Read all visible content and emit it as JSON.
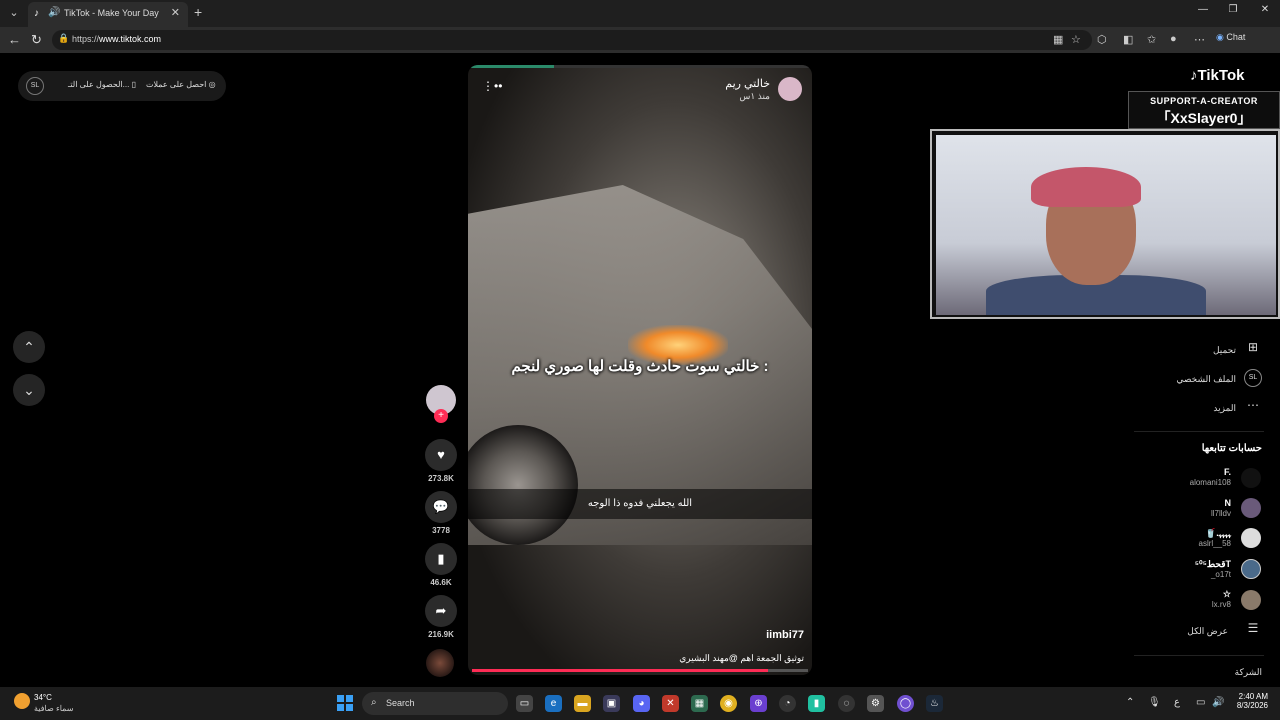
{
  "browser": {
    "tab_title": "TikTok - Make Your Day",
    "url_prefix": "https://",
    "url_host": "www.tiktok.com",
    "chat_label": "Chat"
  },
  "promo": {
    "item1": "احصل على عملات",
    "item2": "الحصول على التـ..."
  },
  "video": {
    "author_display": "خالتي ريم",
    "posted": "منذ ١س",
    "caption_main": "خالتي سوت حادث وقلت لها صوري لنجم :",
    "caption_sub": "الله يجعلني فدوه ذا الوجه",
    "username": "iimbi77",
    "description": "توثيق الجمعة اهم @مهند البشيري",
    "progress_fraction": 0.88
  },
  "actions": {
    "likes": "273.8K",
    "comments": "3778",
    "saves": "46.6K",
    "shares": "216.9K"
  },
  "overlay": {
    "tiktok_logo": "TikTok",
    "banner_line1": "SUPPORT-A-CREATOR",
    "banner_line2": "「XxSlayer0」"
  },
  "sidebar": {
    "upload": "تحميل",
    "profile": "الملف الشخصي",
    "more": "المزيد",
    "following_title": "حسابات تتابعها",
    "following": [
      {
        "name": "F.",
        "user": "alomani108"
      },
      {
        "name": "N",
        "user": "ll7lldv"
      },
      {
        "name": "🥤.ﮩﮩﮩﮩ",
        "user": "aslrl__58"
      },
      {
        "name": "قحط⁵⁰⁵T",
        "user": "_o17t"
      },
      {
        "name": "☆",
        "user": "lx.rv8"
      }
    ],
    "see_all": "عرض الكل",
    "company": "الشركة"
  },
  "taskbar": {
    "temp": "34°C",
    "condition": "سماء صافية",
    "search": "Search",
    "lang": "ع",
    "time": "2:40 AM",
    "date": "8/3/2026"
  }
}
